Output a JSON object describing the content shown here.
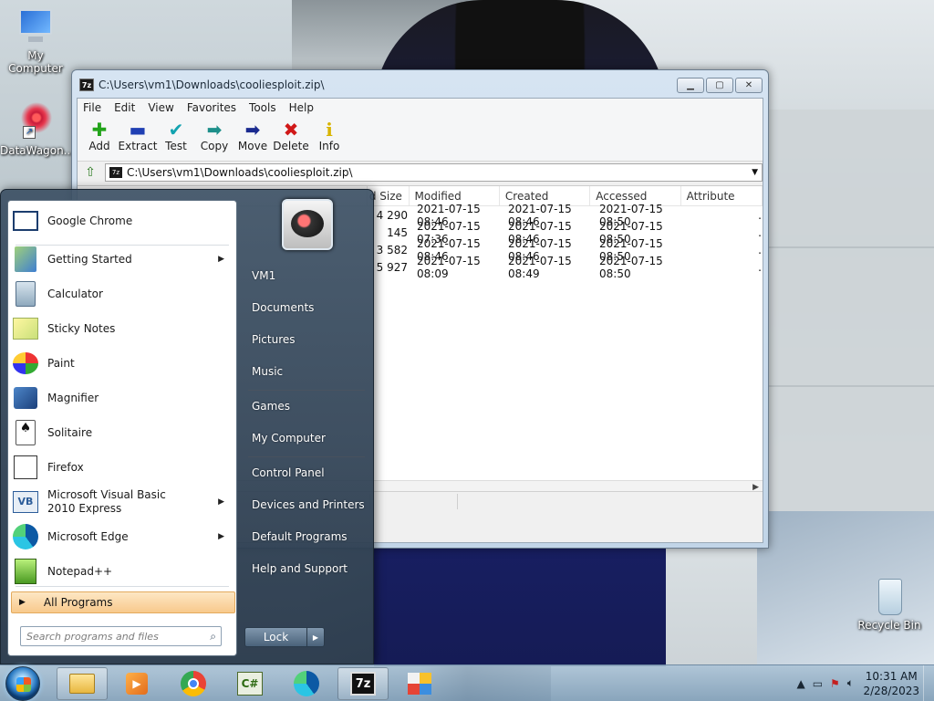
{
  "desktop": {
    "icons": [
      {
        "label": "My Computer"
      },
      {
        "label": "DataWagon..."
      },
      {
        "label": "Recycle Bin"
      }
    ]
  },
  "window": {
    "title": "C:\\Users\\vm1\\Downloads\\cooliesploit.zip\\",
    "menu": [
      "File",
      "Edit",
      "View",
      "Favorites",
      "Tools",
      "Help"
    ],
    "toolbar": [
      {
        "label": "Add",
        "icon": "plus-icon",
        "color": "#22a31a"
      },
      {
        "label": "Extract",
        "icon": "minus-icon",
        "color": "#1f3fb3"
      },
      {
        "label": "Test",
        "icon": "check-icon",
        "color": "#12a3b0"
      },
      {
        "label": "Copy",
        "icon": "double-arrow-icon",
        "color": "#1d8f8a"
      },
      {
        "label": "Move",
        "icon": "arrow-right-icon",
        "color": "#1a2a8f"
      },
      {
        "label": "Delete",
        "icon": "x-icon",
        "color": "#d01818"
      },
      {
        "label": "Info",
        "icon": "info-icon",
        "color": "#d8b400"
      }
    ],
    "address": "C:\\Users\\vm1\\Downloads\\cooliesploit.zip\\",
    "columns": [
      "d Size",
      "Modified",
      "Created",
      "Accessed",
      "Attribute"
    ],
    "rows": [
      {
        "size": "4 290",
        "modified": "2021-07-15 08:46",
        "created": "2021-07-15 08:46",
        "accessed": "2021-07-15 08:50",
        "attr": "."
      },
      {
        "size": "145",
        "modified": "2021-07-15 07:36",
        "created": "2021-07-15 08:46",
        "accessed": "2021-07-15 08:50",
        "attr": "."
      },
      {
        "size": "3 582",
        "modified": "2021-07-15 08:46",
        "created": "2021-07-15 08:46",
        "accessed": "2021-07-15 08:50",
        "attr": "."
      },
      {
        "size": "5 927",
        "modified": "2021-07-15 08:09",
        "created": "2021-07-15 08:49",
        "accessed": "2021-07-15 08:50",
        "attr": "."
      }
    ]
  },
  "start_menu": {
    "programs": [
      {
        "label": "Google Chrome",
        "icon": "chrome-icon",
        "submenu": false
      },
      {
        "label": "Getting Started",
        "icon": "getting-started-icon",
        "submenu": true
      },
      {
        "label": "Calculator",
        "icon": "calculator-icon",
        "submenu": false
      },
      {
        "label": "Sticky Notes",
        "icon": "sticky-notes-icon",
        "submenu": false
      },
      {
        "label": "Paint",
        "icon": "paint-icon",
        "submenu": false
      },
      {
        "label": "Magnifier",
        "icon": "magnifier-icon",
        "submenu": false
      },
      {
        "label": "Solitaire",
        "icon": "solitaire-icon",
        "submenu": false
      },
      {
        "label": "Firefox",
        "icon": "firefox-icon",
        "submenu": false
      },
      {
        "label": "Microsoft Visual Basic 2010 Express",
        "icon": "visual-basic-icon",
        "submenu": true
      },
      {
        "label": "Microsoft Edge",
        "icon": "edge-icon",
        "submenu": true
      },
      {
        "label": "Notepad++",
        "icon": "notepadpp-icon",
        "submenu": false
      }
    ],
    "all_programs": "All Programs",
    "search_placeholder": "Search programs and files",
    "right_links": [
      "VM1",
      "Documents",
      "Pictures",
      "Music",
      "Games",
      "My Computer",
      "Control Panel",
      "Devices and Printers",
      "Default Programs",
      "Help and Support"
    ],
    "lock_label": "Lock"
  },
  "taskbar": {
    "clock_time": "10:31 AM",
    "clock_date": "2/28/2023",
    "pinned": [
      {
        "name": "explorer-icon"
      },
      {
        "name": "media-player-icon"
      },
      {
        "name": "chrome-icon"
      },
      {
        "name": "csharp-icon",
        "label": "C#"
      },
      {
        "name": "edge-icon"
      },
      {
        "name": "7zip-icon",
        "label": "7z"
      },
      {
        "name": "windows-colors-icon"
      }
    ]
  }
}
